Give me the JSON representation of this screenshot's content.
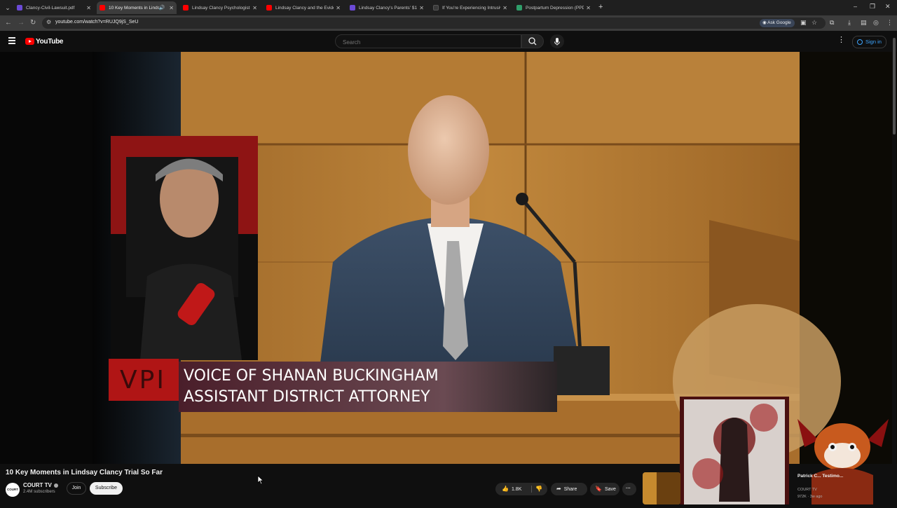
{
  "browser": {
    "tabs": [
      {
        "title": "Clancy-Civil-Lawsuit.pdf",
        "favicon": "pdf",
        "active": false
      },
      {
        "title": "10 Key Moments in Lindsay",
        "favicon": "youtube",
        "active": true,
        "audio": true
      },
      {
        "title": "Lindsay Clancy Psychologist Di",
        "favicon": "youtube",
        "active": false
      },
      {
        "title": "Lindsay Clancy and the Evidenc",
        "favicon": "youtube",
        "active": false
      },
      {
        "title": "Lindsay Clancy's Parents' $1 Mi",
        "favicon": "pdf",
        "active": false
      },
      {
        "title": "If You're Experiencing Intrusiv",
        "favicon": "dark",
        "active": false
      },
      {
        "title": "Postpartum Depression (PPD):",
        "favicon": "green",
        "active": false
      }
    ],
    "url": "youtube.com/watch?v=RUJQ9jS_SeU",
    "ask_google": "Ask Google"
  },
  "youtube": {
    "logo_text": "YouTube",
    "search_placeholder": "Search",
    "signin_label": "Sign in"
  },
  "video": {
    "lower_third_logo": "VPI",
    "lower_third_line1": "VOICE OF SHANAN BUCKINGHAM",
    "lower_third_line2": "ASSISTANT DISTRICT ATTORNEY",
    "title": "10 Key Moments in Lindsay Clancy Trial So Far",
    "channel": {
      "name": "COURT TV",
      "avatar_text": "COURT",
      "subscribers": "2.4M subscribers",
      "join_label": "Join",
      "subscribe_label": "Subscribe"
    },
    "actions": {
      "like_count": "1.8K",
      "share_label": "Share",
      "save_label": "Save",
      "more_label": "···"
    }
  },
  "recommendation": {
    "title": "Patrick C... Testimo...",
    "channel": "COURT TV",
    "meta": "972K · 3w ago"
  },
  "colors": {
    "youtube_red": "#ff0000",
    "link_blue": "#3ea6ff",
    "page_bg": "#0f0f0f"
  }
}
